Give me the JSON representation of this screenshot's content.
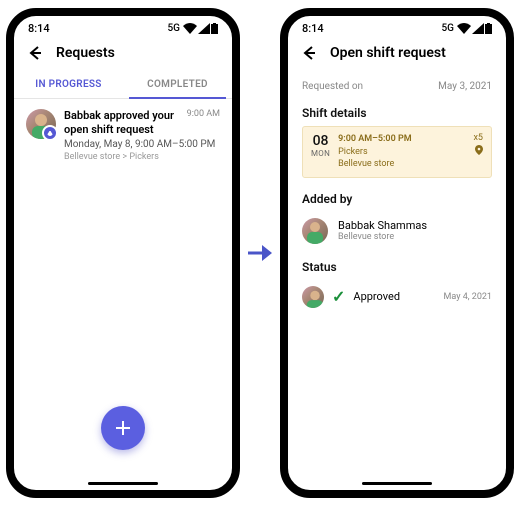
{
  "statusbar": {
    "time": "8:14",
    "network": "5G"
  },
  "phone1": {
    "title": "Requests",
    "tabs": {
      "inprogress": "IN PROGRESS",
      "completed": "COMPLETED"
    },
    "item": {
      "title": "Babbak approved your open shift request",
      "subtitle": "Monday, May 8, 9:00 AM–5:00 PM",
      "location": "Bellevue store > Pickers",
      "time": "9:00 AM"
    }
  },
  "phone2": {
    "title": "Open shift request",
    "requested_label": "Requested on",
    "requested_date": "May 3, 2021",
    "shift_label": "Shift details",
    "shift": {
      "day": "08",
      "dow": "MON",
      "time": "9:00 AM–5:00 PM",
      "group": "Pickers",
      "store": "Bellevue store",
      "count": "x5"
    },
    "added_label": "Added by",
    "added_name": "Babbak Shammas",
    "added_store": "Bellevue store",
    "status_label": "Status",
    "status_text": "Approved",
    "status_date": "May 4, 2021"
  }
}
